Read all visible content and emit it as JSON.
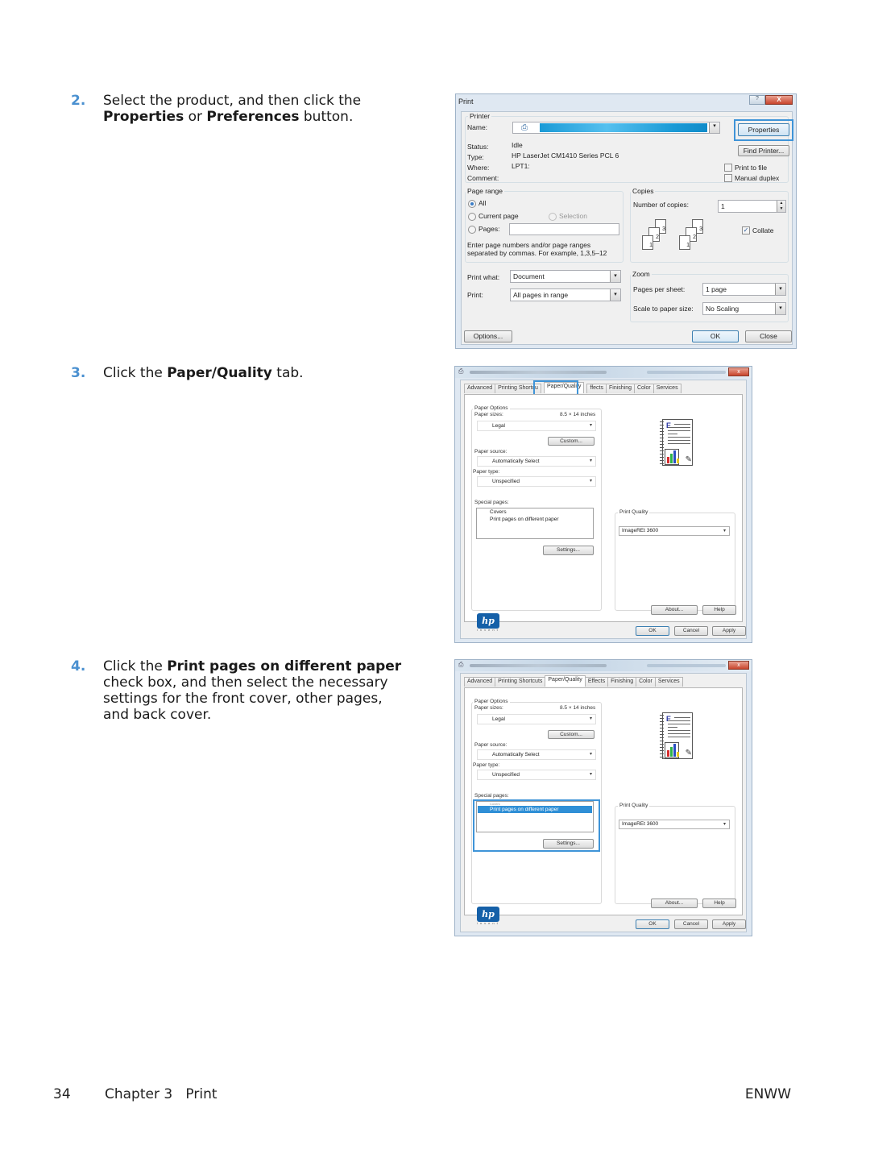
{
  "steps": [
    {
      "num": "2.",
      "parts": [
        "Select the product, and then click the ",
        "Properties",
        " or ",
        "Preferences",
        " button."
      ]
    },
    {
      "num": "3.",
      "parts": [
        "Click the ",
        "Paper/Quality",
        " tab."
      ]
    },
    {
      "num": "4.",
      "parts": [
        "Click the ",
        "Print pages on different paper",
        " check box, and then select the necessary settings for the front cover, other pages, and back cover."
      ]
    }
  ],
  "print_dialog": {
    "title": "Print",
    "help_button": "?",
    "close_button": "X",
    "printer_group": "Printer",
    "name_label": "Name:",
    "status_label": "Status:",
    "status_value": "Idle",
    "type_label": "Type:",
    "type_value": "HP LaserJet CM1410 Series PCL 6",
    "where_label": "Where:",
    "where_value": "LPT1:",
    "comment_label": "Comment:",
    "comment_value": "",
    "properties_button": "Properties",
    "find_printer_button": "Find Printer...",
    "print_to_file": "Print to file",
    "manual_duplex": "Manual duplex",
    "page_range_group": "Page range",
    "all": "All",
    "current_page": "Current page",
    "selection": "Selection",
    "pages": "Pages:",
    "pages_value": "",
    "range_hint_1": "Enter page numbers and/or page ranges",
    "range_hint_2": "separated by commas.  For example, 1,3,5–12",
    "copies_group": "Copies",
    "number_of_copies": "Number of copies:",
    "copies_value": "1",
    "collate": "Collate",
    "collate_checked": true,
    "print_what_label": "Print what:",
    "print_what_value": "Document",
    "print_label": "Print:",
    "print_value": "All pages in range",
    "zoom_group": "Zoom",
    "pages_per_sheet_label": "Pages per sheet:",
    "pages_per_sheet_value": "1 page",
    "scale_label": "Scale to paper size:",
    "scale_value": "No Scaling",
    "options_button": "Options...",
    "ok_button": "OK",
    "cancel_button": "Close"
  },
  "driver_dialog_a": {
    "tabs": [
      "Advanced",
      "Printing Shortcu",
      "Paper/Quality",
      "ffects",
      "Finishing",
      "Color",
      "Services"
    ],
    "active_tab": 2
  },
  "driver_dialog_b": {
    "tabs": [
      "Advanced",
      "Printing Shortcuts",
      "Paper/Quality",
      "Effects",
      "Finishing",
      "Color",
      "Services"
    ],
    "active_tab": 2
  },
  "driver": {
    "paper_options_group": "Paper Options",
    "paper_sizes_label": "Paper sizes:",
    "paper_size_dims": "8.5 × 14 inches",
    "paper_size_value": "Legal",
    "custom_button": "Custom...",
    "paper_source_label": "Paper source:",
    "paper_source_value": "Automatically Select",
    "paper_type_label": "Paper type:",
    "paper_type_value": "Unspecified",
    "special_pages_label": "Special pages:",
    "special_pages_items": [
      "Covers",
      "Print pages on different paper"
    ],
    "settings_button": "Settings...",
    "print_quality_group": "Print Quality",
    "print_quality_value": "ImageREt 3600",
    "hp_logo": "hp",
    "hp_tagline": "invent",
    "about_button": "About...",
    "help_button": "Help",
    "ok_button": "OK",
    "cancel_button": "Cancel",
    "apply_button": "Apply",
    "close_glyph": "x",
    "dropdown_glyph": "▾"
  },
  "footer": {
    "page_number": "34",
    "chapter": "Chapter 3   Print",
    "right": "ENWW"
  },
  "colors": {
    "step_number": "#4a90d0",
    "highlight": "#3f94d8",
    "selection": "#2f8fd6"
  }
}
